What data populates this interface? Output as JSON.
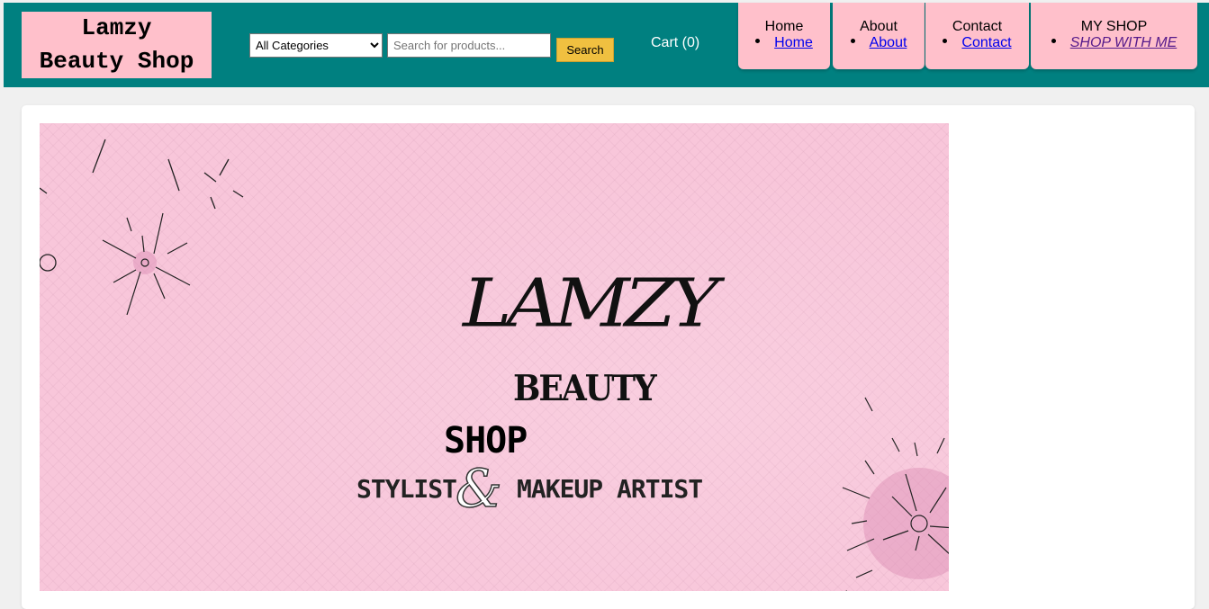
{
  "header": {
    "logo_text": "Lamzy\nBeauty Shop",
    "search": {
      "category_selected": "All Categories",
      "placeholder": "Search for products...",
      "value": "",
      "button_label": "Search"
    },
    "cart_label": "Cart (0)"
  },
  "nav": [
    {
      "title": "Home",
      "link": "Home"
    },
    {
      "title": "About",
      "link": "About"
    },
    {
      "title": "Contact",
      "link": "Contact"
    },
    {
      "title": "MY SHOP",
      "link": "SHOP WITH ME"
    }
  ],
  "banner": {
    "script_name": "LAMZY",
    "line_beauty": "BEAUTY",
    "line_shop": "SHOP",
    "line_stylist": "STYLIST",
    "line_amp": "&",
    "line_makeup": "MAKEUP ARTIST"
  },
  "colors": {
    "header_bg": "#008080",
    "nav_card_bg": "#ffc0cb",
    "search_button_bg": "#f0c040",
    "banner_bg": "#f8c6da"
  }
}
